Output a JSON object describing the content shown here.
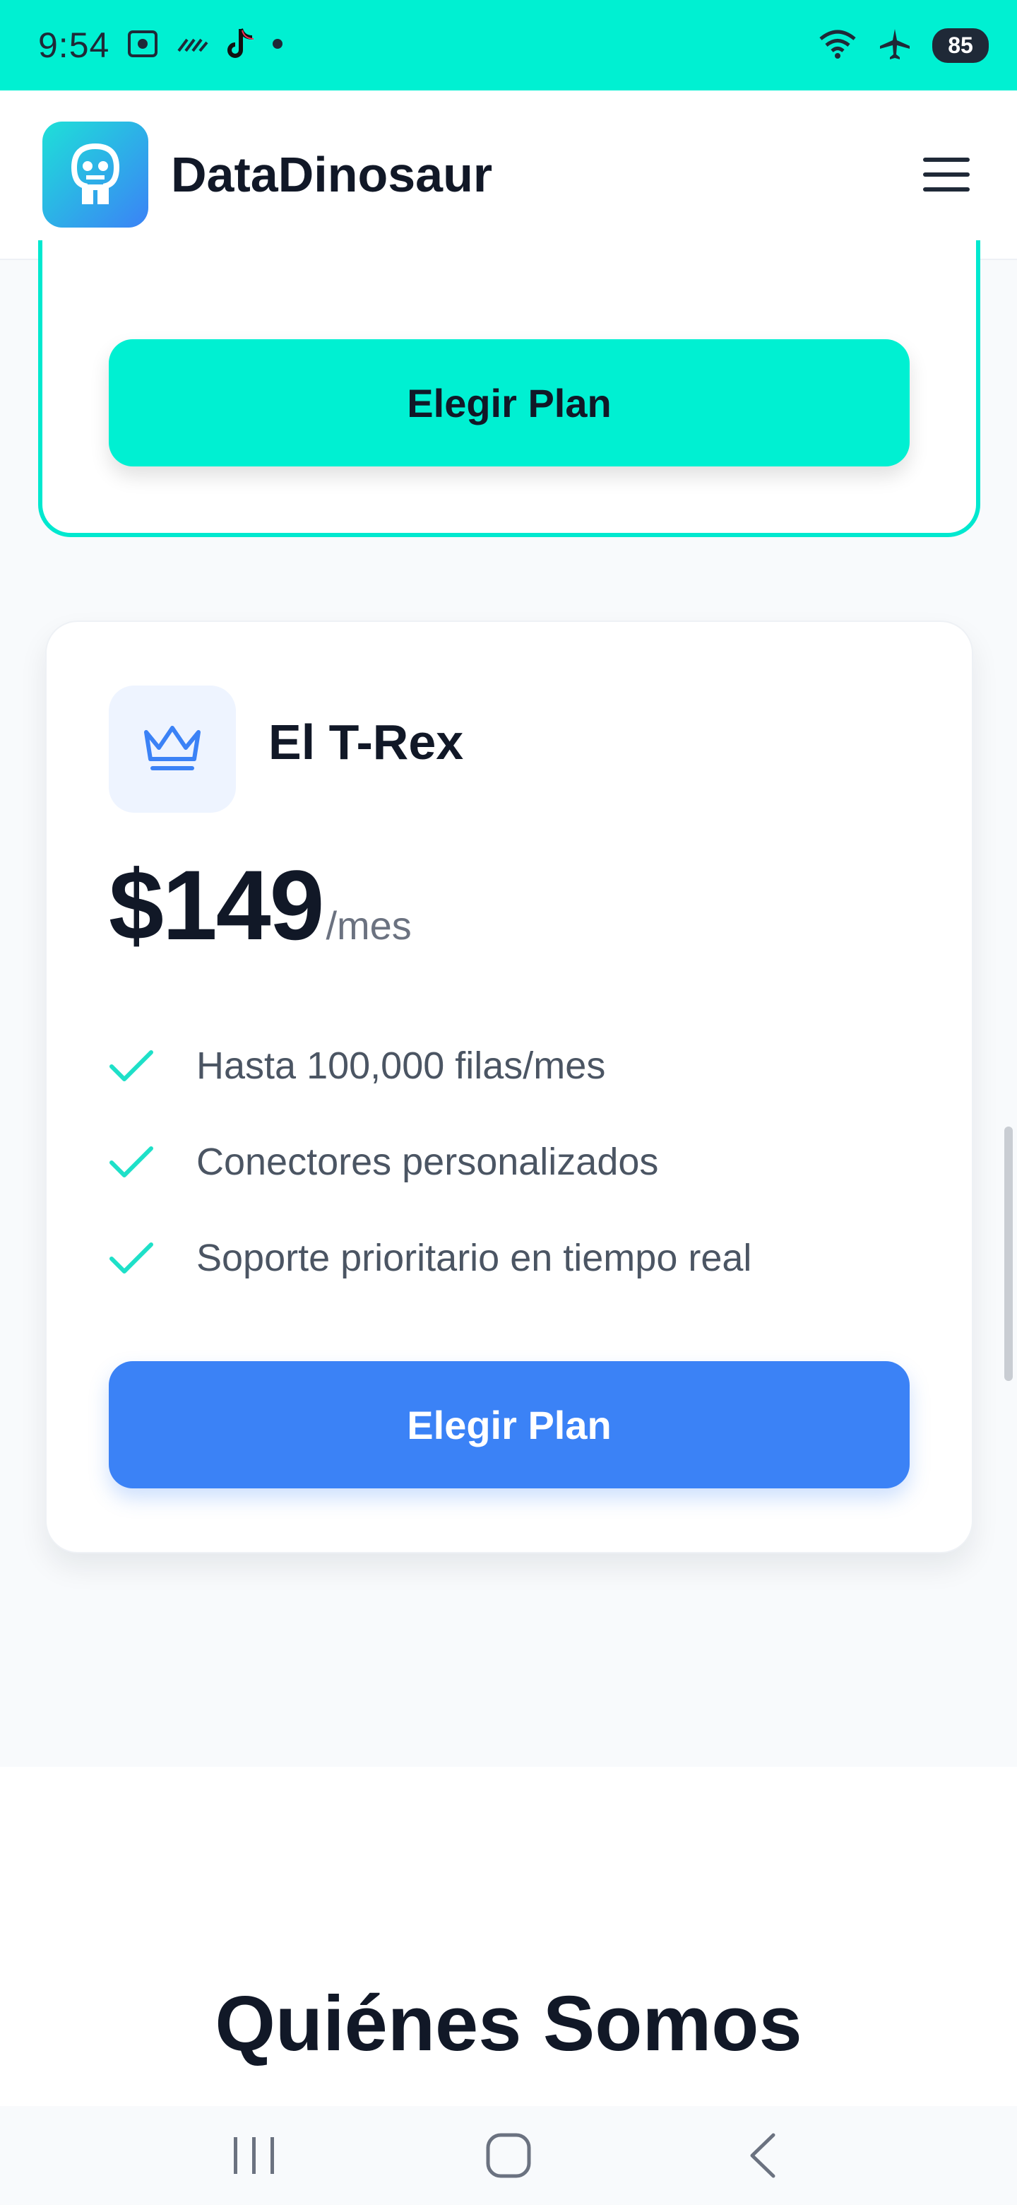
{
  "status_bar": {
    "time": "9:54",
    "battery": "85"
  },
  "header": {
    "brand": "DataDinosaur"
  },
  "previous_plan": {
    "button_label": "Elegir Plan"
  },
  "plan": {
    "name": "El T-Rex",
    "price": "$149",
    "period": "/mes",
    "features": [
      "Hasta 100,000 filas/mes",
      "Conectores personalizados",
      "Soporte prioritario en tiempo real"
    ],
    "button_label": "Elegir Plan"
  },
  "about": {
    "title": "Quiénes Somos"
  },
  "colors": {
    "accent_teal": "#00f0d2",
    "primary_blue": "#3b82f6",
    "text_dark": "#111827"
  }
}
